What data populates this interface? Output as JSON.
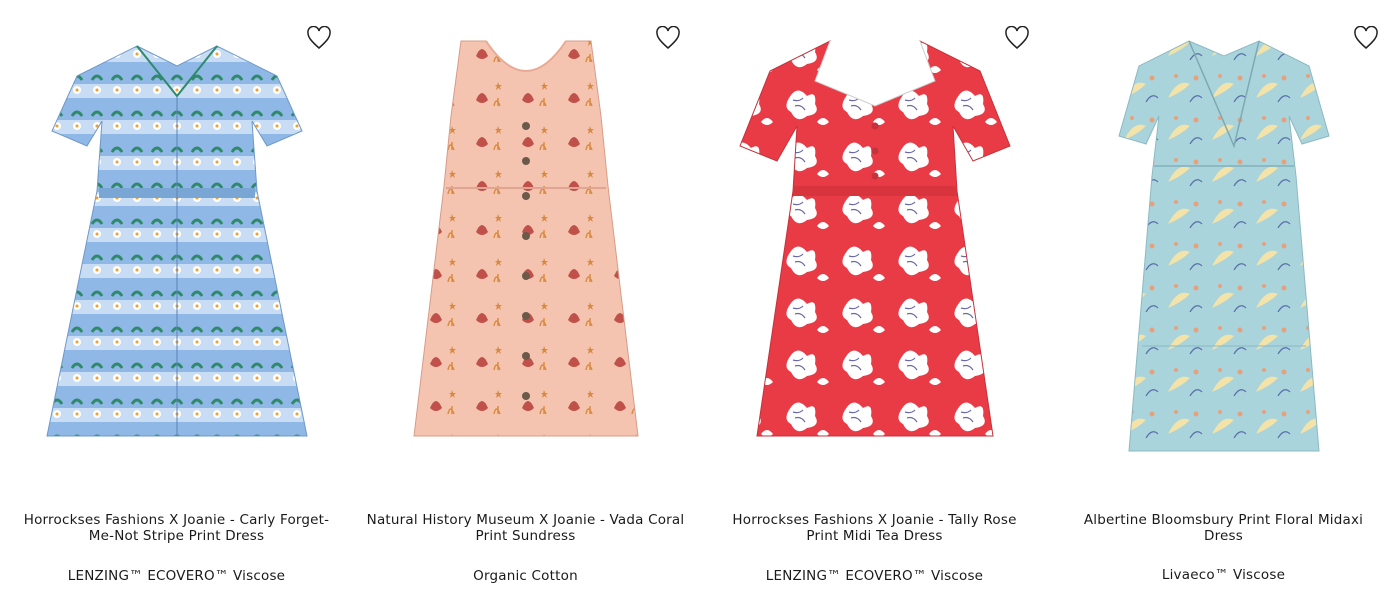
{
  "products": [
    {
      "title": "Horrockses Fashions X Joanie - Carly Forget-Me-Not Stripe Print Dress",
      "fabric": "LENZING™ ECOVERO™ Viscose",
      "colors": {
        "base": "#8fb8e6",
        "accent": "#2e8a6a",
        "flower": "#ffffff"
      }
    },
    {
      "title": "Natural History Museum X Joanie - Vada Coral Print Sundress",
      "fabric": "Organic Cotton",
      "colors": {
        "base": "#f4c4b0",
        "accent": "#d9893a",
        "flower": "#c0504a"
      }
    },
    {
      "title": "Horrockses Fashions X Joanie - Tally Rose Print Midi Tea Dress",
      "fabric": "LENZING™ ECOVERO™ Viscose",
      "colors": {
        "base": "#e93b45",
        "accent": "#ffffff",
        "flower": "#6a6aa8"
      }
    },
    {
      "title": "Albertine Bloomsbury Print Floral Midaxi Dress",
      "fabric": "Livaeco™ Viscose",
      "colors": {
        "base": "#a9d4dc",
        "accent": "#e7a07a",
        "flower": "#f3e3a9"
      }
    }
  ],
  "icons": {
    "wishlist": "heart-outline-icon"
  }
}
